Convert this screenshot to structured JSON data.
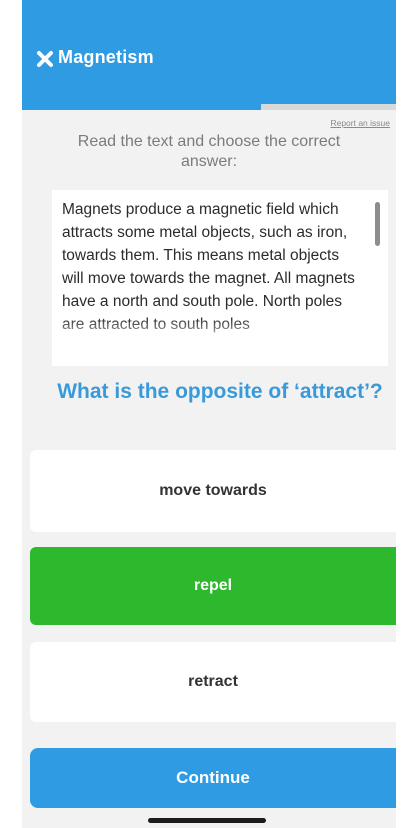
{
  "header": {
    "title": "Magnetism",
    "close_icon": "close-x-icon",
    "color": "#2f9be3"
  },
  "progress": {
    "fraction": 0.64
  },
  "report_link": "Report an issue",
  "instruction": "Read the text and choose the correct answer:",
  "passage": {
    "text": "Magnets produce a magnetic field which attracts some metal objects, such as iron, towards them. This means metal objects will move towards the magnet. All magnets have a north and south pole. North poles are attracted to south poles"
  },
  "question": "What is the opposite of ‘attract’?",
  "options": [
    {
      "label": "move towards",
      "selected": false
    },
    {
      "label": "repel",
      "selected": true,
      "color": "#2eb82e"
    },
    {
      "label": "retract",
      "selected": false
    }
  ],
  "continue_label": "Continue"
}
